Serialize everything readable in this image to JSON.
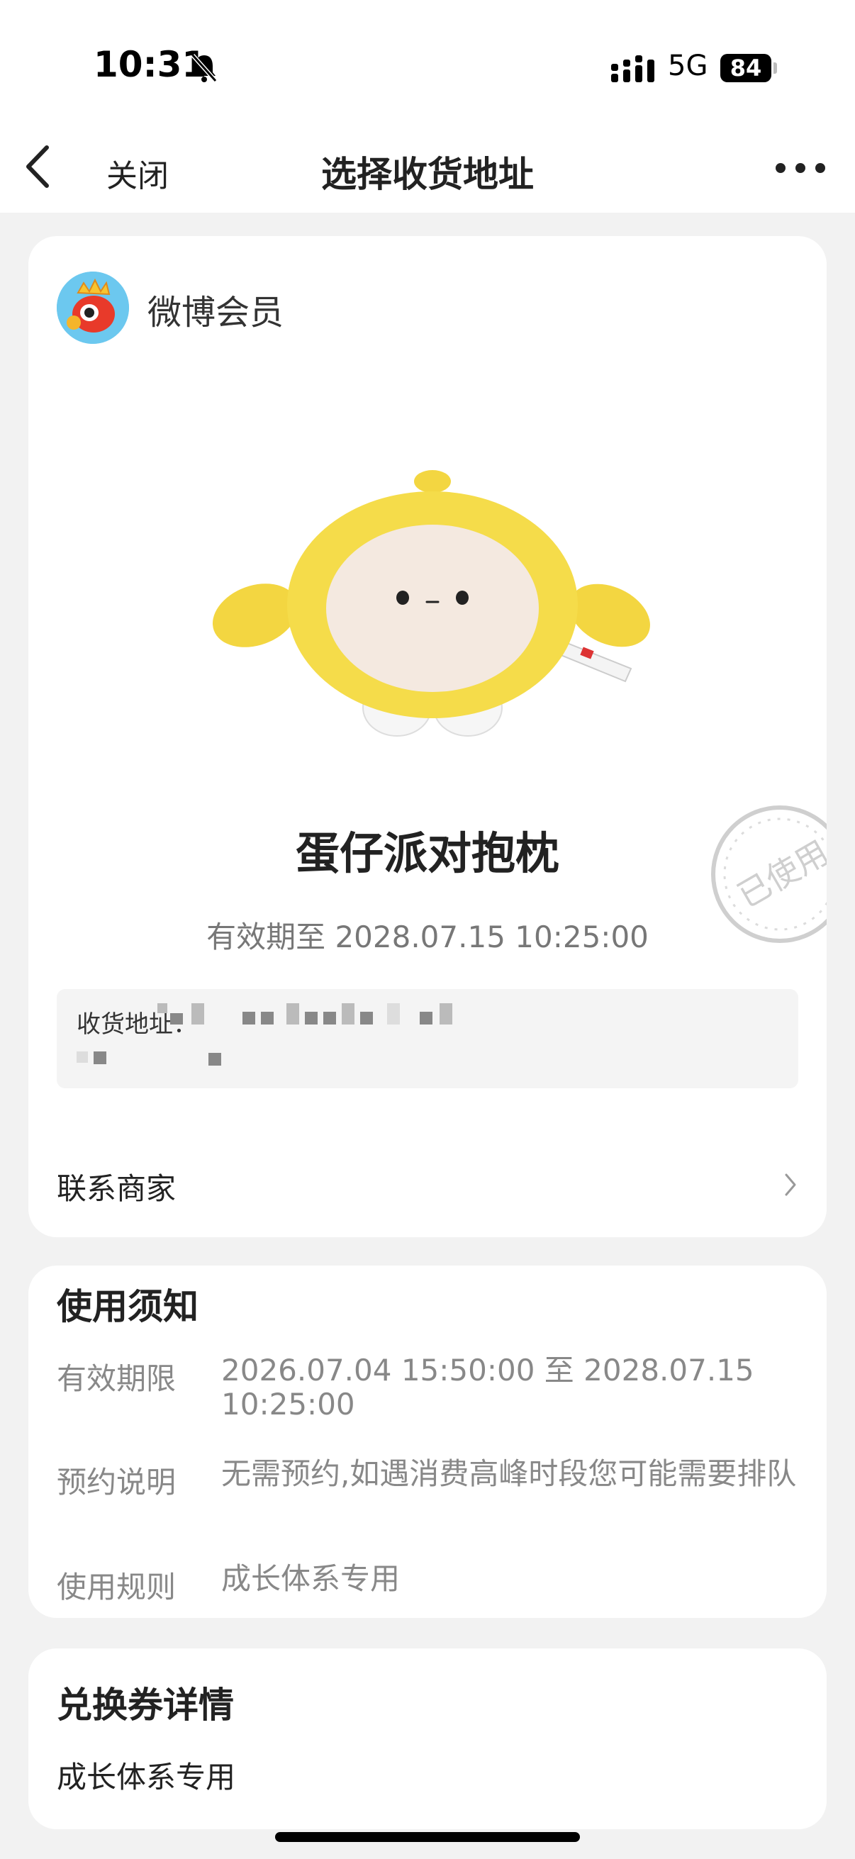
{
  "status_bar": {
    "time": "10:31",
    "network": "5G",
    "battery": "84"
  },
  "nav": {
    "close_label": "关闭",
    "title": "选择收货地址"
  },
  "brand": {
    "name": "微博会员"
  },
  "product": {
    "name": "蛋仔派对抱枕",
    "validity": "有效期至 2028.07.15 10:25:00",
    "stamp_text": "已使用"
  },
  "address": {
    "label": "收货地址："
  },
  "contact": {
    "label": "联系商家"
  },
  "notice": {
    "title": "使用须知",
    "rows": [
      {
        "label": "有效期限",
        "value": "2026.07.04 15:50:00 至 2028.07.15 10:25:00"
      },
      {
        "label": "预约说明",
        "value": "无需预约,如遇消费高峰时段您可能需要排队"
      },
      {
        "label": "使用规则",
        "value": "成长体系专用"
      }
    ]
  },
  "details": {
    "title": "兑换券详情",
    "text": "成长体系专用"
  },
  "colors": {
    "background": "#f2f2f2",
    "card": "#ffffff",
    "plush_yellow": "#f5dc4a"
  }
}
